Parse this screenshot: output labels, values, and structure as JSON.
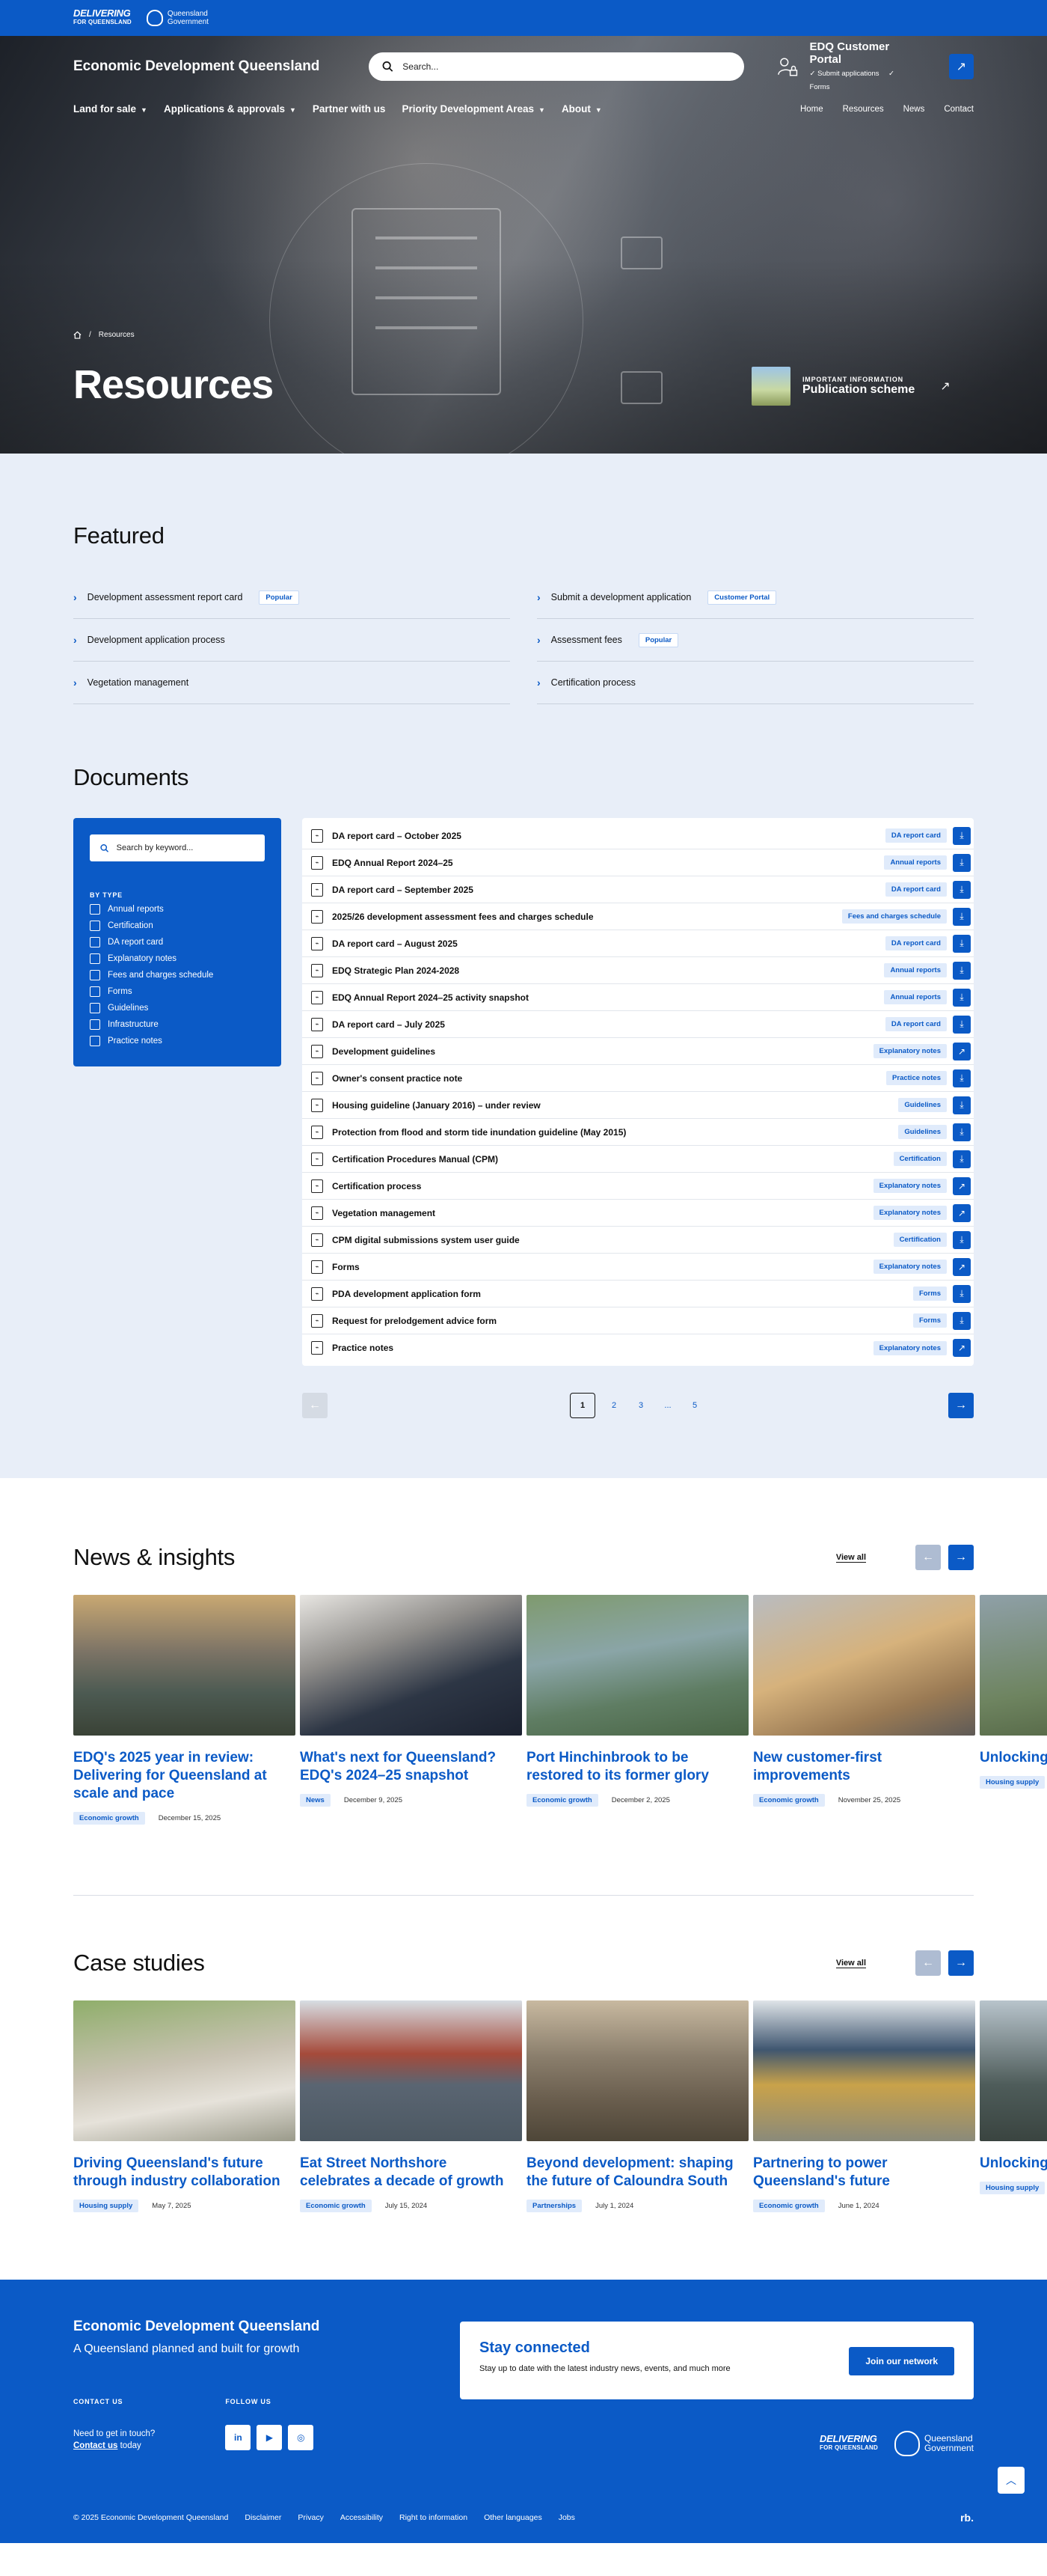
{
  "topbar": {
    "logo_delivering": "DELIVERING",
    "logo_for_qld": "FOR QUEENSLAND",
    "logo_qld_1": "Queensland",
    "logo_qld_2": "Government"
  },
  "header": {
    "site_title": "Economic Development Queensland",
    "search_placeholder": "Search...",
    "portal_title": "EDQ Customer Portal",
    "portal_item_1": "✓ Submit applications",
    "portal_item_2": "✓ Forms"
  },
  "nav": {
    "main": [
      "Land for sale",
      "Applications & approvals",
      "Partner with us",
      "Priority Development Areas",
      "About"
    ],
    "util": [
      "Home",
      "Resources",
      "News",
      "Contact"
    ]
  },
  "hero": {
    "breadcrumb_current": "Resources",
    "title": "Resources",
    "pub_label": "IMPORTANT INFORMATION",
    "pub_title": "Publication scheme"
  },
  "featured": {
    "heading": "Featured",
    "left": [
      {
        "label": "Development assessment report card",
        "tag": "Popular"
      },
      {
        "label": "Development application process",
        "tag": ""
      },
      {
        "label": "Vegetation management",
        "tag": ""
      }
    ],
    "right": [
      {
        "label": "Submit a development application",
        "tag": "Customer Portal"
      },
      {
        "label": "Assessment fees",
        "tag": "Popular"
      },
      {
        "label": "Certification process",
        "tag": ""
      }
    ]
  },
  "documents": {
    "heading": "Documents",
    "search_placeholder": "Search by keyword...",
    "filter_label": "BY TYPE",
    "filters": [
      "Annual reports",
      "Certification",
      "DA report card",
      "Explanatory notes",
      "Fees and charges schedule",
      "Forms",
      "Guidelines",
      "Infrastructure",
      "Practice notes"
    ],
    "rows": [
      {
        "title": "DA report card – October 2025",
        "tag": "DA report card",
        "action": "download"
      },
      {
        "title": "EDQ Annual Report 2024–25",
        "tag": "Annual reports",
        "action": "download"
      },
      {
        "title": "DA report card – September 2025",
        "tag": "DA report card",
        "action": "download"
      },
      {
        "title": "2025/26 development assessment fees and charges schedule",
        "tag": "Fees and charges schedule",
        "action": "download"
      },
      {
        "title": "DA report card – August 2025",
        "tag": "DA report card",
        "action": "download"
      },
      {
        "title": "EDQ Strategic Plan 2024-2028",
        "tag": "Annual reports",
        "action": "download"
      },
      {
        "title": "EDQ Annual Report 2024–25 activity snapshot",
        "tag": "Annual reports",
        "action": "download"
      },
      {
        "title": "DA report card – July 2025",
        "tag": "DA report card",
        "action": "download"
      },
      {
        "title": "Development guidelines",
        "tag": "Explanatory notes",
        "action": "link"
      },
      {
        "title": "Owner's consent practice note",
        "tag": "Practice notes",
        "action": "download"
      },
      {
        "title": "Housing guideline (January 2016) – under review",
        "tag": "Guidelines",
        "action": "download"
      },
      {
        "title": "Protection from flood and storm tide inundation guideline (May 2015)",
        "tag": "Guidelines",
        "action": "download"
      },
      {
        "title": "Certification Procedures Manual (CPM)",
        "tag": "Certification",
        "action": "download"
      },
      {
        "title": "Certification process",
        "tag": "Explanatory notes",
        "action": "link"
      },
      {
        "title": "Vegetation management",
        "tag": "Explanatory notes",
        "action": "link"
      },
      {
        "title": "CPM digital submissions system user guide",
        "tag": "Certification",
        "action": "download"
      },
      {
        "title": "Forms",
        "tag": "Explanatory notes",
        "action": "link"
      },
      {
        "title": "PDA development application form",
        "tag": "Forms",
        "action": "download"
      },
      {
        "title": "Request for prelodgement advice form",
        "tag": "Forms",
        "action": "download"
      },
      {
        "title": "Practice notes",
        "tag": "Explanatory notes",
        "action": "link"
      }
    ],
    "pages": [
      "1",
      "2",
      "3",
      "...",
      "5"
    ]
  },
  "news": {
    "heading": "News & insights",
    "view_all": "View all",
    "cards": [
      {
        "title": "EDQ's 2025 year in review: Delivering for Queensland at scale and pace",
        "tag": "Economic growth",
        "date": "December 15, 2025",
        "img": "linear-gradient(180deg,#c9a872 0%,#7d7466 40%,#4c5a52 70%,#3a4236 100%)"
      },
      {
        "title": "What's next for Queensland? EDQ's 2024–25 snapshot",
        "tag": "News",
        "date": "December 9, 2025",
        "img": "linear-gradient(160deg,#e8e6e2 0%,#8f8d8a 35%,#2d3645 65%,#1c2230 100%)"
      },
      {
        "title": "Port Hinchinbrook to be restored to its former glory",
        "tag": "Economic growth",
        "date": "December 2, 2025",
        "img": "linear-gradient(170deg,#7f9a6e 0%,#8aa5a7 40%,#5f7d63 70%,#4a6546 100%)"
      },
      {
        "title": "New customer-first improvements",
        "tag": "Economic growth",
        "date": "November 25, 2025",
        "img": "linear-gradient(160deg,#b9bcc0 0%,#d6b27c 45%,#9a7a54 75%,#5e5a56 100%)"
      },
      {
        "title": "Unlocking homes in R",
        "tag": "Housing supply",
        "date": "",
        "img": "linear-gradient(170deg,#8fa0a8 0%,#6e8460 60%,#4d5e3e 100%)"
      }
    ]
  },
  "case_studies": {
    "heading": "Case studies",
    "view_all": "View all",
    "cards": [
      {
        "title": "Driving Queensland's future through industry collaboration",
        "tag": "Housing supply",
        "date": "May 7, 2025",
        "img": "linear-gradient(170deg,#8fae6a 0%,#c8c2b2 45%,#e6e2da 70%,#9a9a8a 100%)"
      },
      {
        "title": "Eat Street Northshore celebrates a decade of growth",
        "tag": "Economic growth",
        "date": "July 15, 2024",
        "img": "linear-gradient(180deg,#d7dde3 0%,#a54a3a 38%,#5a6572 60%,#4c5862 100%)"
      },
      {
        "title": "Beyond development: shaping the future of Caloundra South",
        "tag": "Partnerships",
        "date": "July 1, 2024",
        "img": "linear-gradient(180deg,#c8b9a0 0%,#8a7e6c 40%,#6a5e4e 70%,#4e4638 100%)"
      },
      {
        "title": "Partnering to power Queensland's future",
        "tag": "Economic growth",
        "date": "June 1, 2024",
        "img": "linear-gradient(180deg,#dfe4e8 0%,#3f5670 35%,#c9a24a 60%,#8a8a7a 100%)"
      },
      {
        "title": "Unlocking more hous",
        "tag": "Housing supply",
        "date": "",
        "img": "linear-gradient(180deg,#b8c4cc 0%,#4e5c5a 60%,#3a4440 100%)"
      }
    ]
  },
  "footer": {
    "title": "Economic Development Queensland",
    "subtitle": "A Queensland planned and built for growth",
    "stay_title": "Stay connected",
    "stay_text": "Stay up to date with the latest industry news, events, and much more",
    "join_label": "Join our network",
    "contact_heading": "CONTACT US",
    "contact_text": "Need to get in touch?",
    "contact_link": "Contact us",
    "contact_suffix": " today",
    "follow_heading": "FOLLOW US",
    "social": [
      "in",
      "▶",
      "◎"
    ],
    "copyright": "© 2025 Economic Development Queensland",
    "links": [
      "Disclaimer",
      "Privacy",
      "Accessibility",
      "Right to information",
      "Other languages",
      "Jobs"
    ],
    "rb": "rb."
  }
}
